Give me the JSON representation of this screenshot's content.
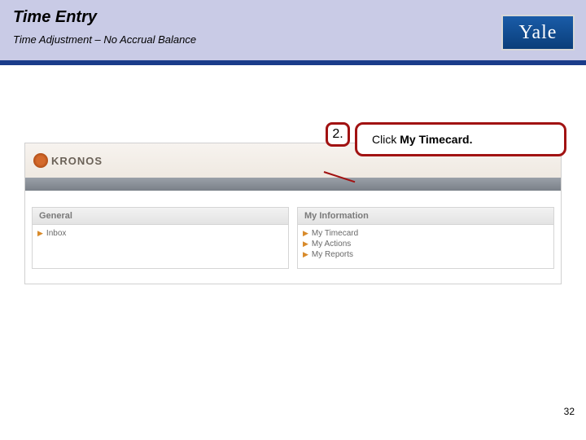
{
  "header": {
    "title": "Time Entry",
    "subtitle": "Time Adjustment – No Accrual Balance",
    "logo_text": "Yale"
  },
  "callout": {
    "number": "2.",
    "text_prefix": "Click ",
    "text_bold": "My Timecard."
  },
  "app": {
    "brand": "KRONOS",
    "panels": {
      "general": {
        "title": "General",
        "items": [
          "Inbox"
        ]
      },
      "myinfo": {
        "title": "My Information",
        "items": [
          "My Timecard",
          "My Actions",
          "My Reports"
        ]
      }
    }
  },
  "page_number": "32"
}
